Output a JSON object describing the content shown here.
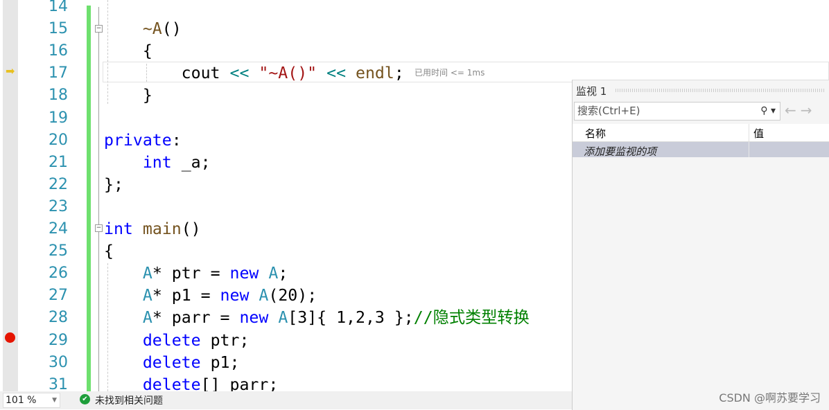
{
  "editor": {
    "lines": [
      {
        "n": "14",
        "t": []
      },
      {
        "n": "15",
        "t": [
          [
            "    ",
            "pl"
          ],
          [
            "~A",
            "fn"
          ],
          [
            "()",
            "pl"
          ]
        ]
      },
      {
        "n": "16",
        "t": [
          [
            "    {",
            "pl"
          ]
        ]
      },
      {
        "n": "17",
        "t": [
          [
            "        cout ",
            "pl"
          ],
          [
            "<<",
            "op"
          ],
          [
            " ",
            "pl"
          ],
          [
            "\"~A()\"",
            "str"
          ],
          [
            " ",
            "pl"
          ],
          [
            "<<",
            "op"
          ],
          [
            " ",
            "pl"
          ],
          [
            "endl",
            "fn"
          ],
          [
            ";",
            "pl"
          ]
        ]
      },
      {
        "n": "18",
        "t": [
          [
            "    }",
            "pl"
          ]
        ]
      },
      {
        "n": "19",
        "t": []
      },
      {
        "n": "20",
        "t": [
          [
            "private",
            "kw"
          ],
          [
            ":",
            "pl"
          ]
        ]
      },
      {
        "n": "21",
        "t": [
          [
            "    ",
            "pl"
          ],
          [
            "int",
            "kw"
          ],
          [
            " _a;",
            "pl"
          ]
        ]
      },
      {
        "n": "22",
        "t": [
          [
            "};",
            "pl"
          ]
        ]
      },
      {
        "n": "23",
        "t": []
      },
      {
        "n": "24",
        "t": [
          [
            "int",
            "kw"
          ],
          [
            " ",
            "pl"
          ],
          [
            "main",
            "fn"
          ],
          [
            "()",
            "pl"
          ]
        ]
      },
      {
        "n": "25",
        "t": [
          [
            "{",
            "pl"
          ]
        ]
      },
      {
        "n": "26",
        "t": [
          [
            "    ",
            "pl"
          ],
          [
            "A",
            "ty"
          ],
          [
            "* ptr = ",
            "pl"
          ],
          [
            "new",
            "kw"
          ],
          [
            " ",
            "pl"
          ],
          [
            "A",
            "ty"
          ],
          [
            ";",
            "pl"
          ]
        ]
      },
      {
        "n": "27",
        "t": [
          [
            "    ",
            "pl"
          ],
          [
            "A",
            "ty"
          ],
          [
            "* p1 = ",
            "pl"
          ],
          [
            "new",
            "kw"
          ],
          [
            " ",
            "pl"
          ],
          [
            "A",
            "ty"
          ],
          [
            "(20);",
            "pl"
          ]
        ]
      },
      {
        "n": "28",
        "t": [
          [
            "    ",
            "pl"
          ],
          [
            "A",
            "ty"
          ],
          [
            "* parr = ",
            "pl"
          ],
          [
            "new",
            "kw"
          ],
          [
            " ",
            "pl"
          ],
          [
            "A",
            "ty"
          ],
          [
            "[3]{ 1,2,3 };",
            "pl"
          ],
          [
            "//隐式类型转换",
            "cm"
          ]
        ]
      },
      {
        "n": "29",
        "t": [
          [
            "    ",
            "pl"
          ],
          [
            "delete",
            "kw"
          ],
          [
            " ptr;",
            "pl"
          ]
        ]
      },
      {
        "n": "30",
        "t": [
          [
            "    ",
            "pl"
          ],
          [
            "delete",
            "kw"
          ],
          [
            " p1;",
            "pl"
          ]
        ]
      },
      {
        "n": "31",
        "t": [
          [
            "    ",
            "pl"
          ],
          [
            "delete",
            "kw"
          ],
          [
            "[] parr;",
            "pl"
          ]
        ]
      }
    ],
    "timing": "已用时间 <= 1ms"
  },
  "watch": {
    "title": "监视 1",
    "search_placeholder": "搜索(Ctrl+E)",
    "col_name": "名称",
    "col_value": "值",
    "add_item": "添加要监视的项"
  },
  "status": {
    "zoom": "101 %",
    "message": "未找到相关问题"
  },
  "watermark": "CSDN @啊苏要学习"
}
